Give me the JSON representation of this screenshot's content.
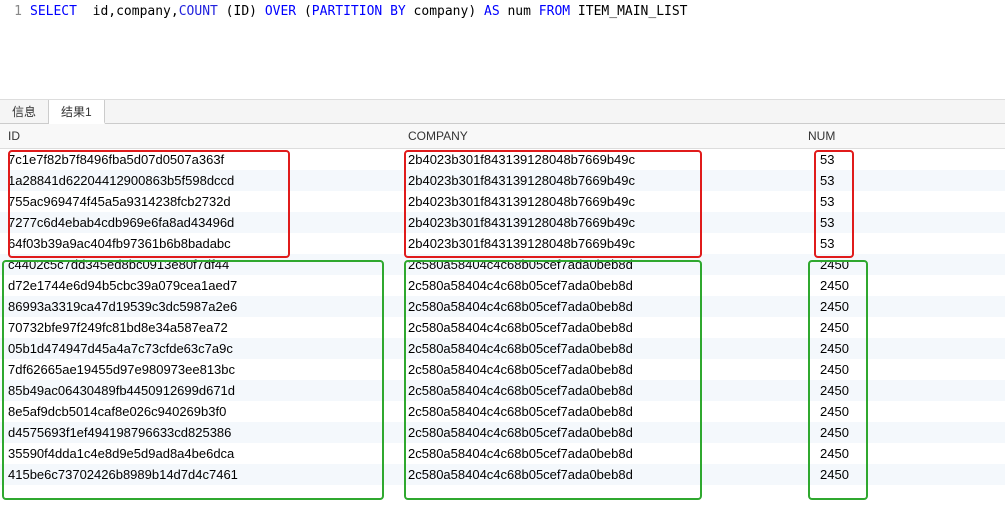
{
  "editor": {
    "line_number": "1",
    "sql_tokens": [
      {
        "t": "SELECT",
        "c": "kw"
      },
      {
        "t": "  id,company,",
        "c": ""
      },
      {
        "t": "COUNT",
        "c": "fn"
      },
      {
        "t": " (ID) ",
        "c": ""
      },
      {
        "t": "OVER",
        "c": "kw"
      },
      {
        "t": " (",
        "c": ""
      },
      {
        "t": "PARTITION BY",
        "c": "kw"
      },
      {
        "t": " company) ",
        "c": ""
      },
      {
        "t": "AS",
        "c": "kw"
      },
      {
        "t": " num ",
        "c": ""
      },
      {
        "t": "FROM",
        "c": "kw"
      },
      {
        "t": " ITEM_MAIN_LIST",
        "c": ""
      }
    ]
  },
  "tabs": {
    "info": "信息",
    "result1": "结果1"
  },
  "columns": {
    "id": "ID",
    "company": "COMPANY",
    "num": "NUM"
  },
  "rows": [
    {
      "id": "7c1e7f82b7f8496fba5d07d0507a363f",
      "company": "2b4023b301f843139128048b7669b49c",
      "num": "53",
      "group": "red"
    },
    {
      "id": "1a28841d62204412900863b5f598dccd",
      "company": "2b4023b301f843139128048b7669b49c",
      "num": "53",
      "group": "red"
    },
    {
      "id": "755ac969474f45a5a9314238fcb2732d",
      "company": "2b4023b301f843139128048b7669b49c",
      "num": "53",
      "group": "red"
    },
    {
      "id": "7277c6d4ebab4cdb969e6fa8ad43496d",
      "company": "2b4023b301f843139128048b7669b49c",
      "num": "53",
      "group": "red"
    },
    {
      "id": "64f03b39a9ac404fb97361b6b8badabc",
      "company": "2b4023b301f843139128048b7669b49c",
      "num": "53",
      "group": "red"
    },
    {
      "id": "c4402c5c7dd345ed8bc0913e80f7df44",
      "company": "2c580a58404c4c68b05cef7ada0beb8d",
      "num": "2450",
      "group": "green"
    },
    {
      "id": "d72e1744e6d94b5cbc39a079cea1aed7",
      "company": "2c580a58404c4c68b05cef7ada0beb8d",
      "num": "2450",
      "group": "green"
    },
    {
      "id": "86993a3319ca47d19539c3dc5987a2e6",
      "company": "2c580a58404c4c68b05cef7ada0beb8d",
      "num": "2450",
      "group": "green"
    },
    {
      "id": "70732bfe97f249fc81bd8e34a587ea72",
      "company": "2c580a58404c4c68b05cef7ada0beb8d",
      "num": "2450",
      "group": "green"
    },
    {
      "id": "05b1d474947d45a4a7c73cfde63c7a9c",
      "company": "2c580a58404c4c68b05cef7ada0beb8d",
      "num": "2450",
      "group": "green"
    },
    {
      "id": "7df62665ae19455d97e980973ee813bc",
      "company": "2c580a58404c4c68b05cef7ada0beb8d",
      "num": "2450",
      "group": "green"
    },
    {
      "id": "85b49ac06430489fb4450912699d671d",
      "company": "2c580a58404c4c68b05cef7ada0beb8d",
      "num": "2450",
      "group": "green"
    },
    {
      "id": "8e5af9dcb5014caf8e026c940269b3f0",
      "company": "2c580a58404c4c68b05cef7ada0beb8d",
      "num": "2450",
      "group": "green"
    },
    {
      "id": "d4575693f1ef494198796633cd825386",
      "company": "2c580a58404c4c68b05cef7ada0beb8d",
      "num": "2450",
      "group": "green"
    },
    {
      "id": "35590f4dda1c4e8d9e5d9ad8a4be6dca",
      "company": "2c580a58404c4c68b05cef7ada0beb8d",
      "num": "2450",
      "group": "green"
    },
    {
      "id": "415be6c73702426b8989b14d7d4c7461",
      "company": "2c580a58404c4c68b05cef7ada0beb8d",
      "num": "2450",
      "group": "green"
    }
  ],
  "annotations": {
    "red": {
      "id_box": true,
      "company_box": true,
      "num_box": true
    },
    "green": {
      "id_box": true,
      "company_box": true,
      "num_box": true
    }
  }
}
